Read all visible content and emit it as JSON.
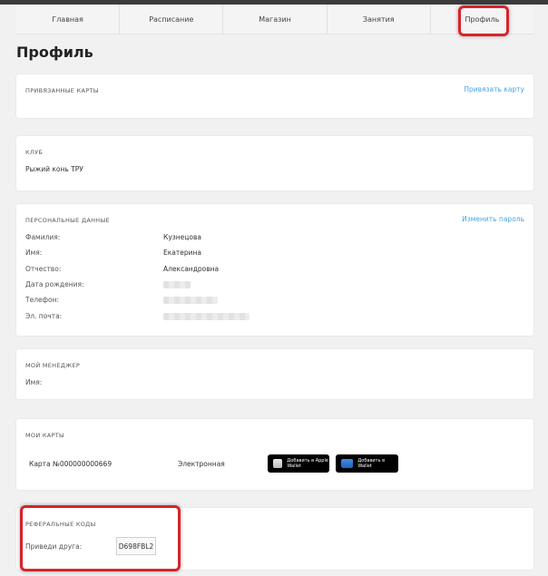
{
  "nav": {
    "items": [
      {
        "label": "Главная"
      },
      {
        "label": "Расписание"
      },
      {
        "label": "Магазин"
      },
      {
        "label": "Занятия"
      },
      {
        "label": "Профиль"
      }
    ]
  },
  "page": {
    "title": "Профиль"
  },
  "linked_cards": {
    "title": "ПРИВЯЗАННЫЕ КАРТЫ",
    "link": "Привязать карту"
  },
  "club": {
    "title": "КЛУБ",
    "value": "Рыжий конь ТРУ"
  },
  "personal": {
    "title": "ПЕРСОНАЛЬНЫЕ ДАННЫЕ",
    "link": "Изменить пароль",
    "fields": [
      {
        "label": "Фамилия:",
        "value": "Кузнецова"
      },
      {
        "label": "Имя:",
        "value": "Екатерина"
      },
      {
        "label": "Отчество:",
        "value": "Александровна"
      },
      {
        "label": "Дата рождения:",
        "value": ""
      },
      {
        "label": "Телефон:",
        "value": ""
      },
      {
        "label": "Эл. почта:",
        "value": ""
      }
    ]
  },
  "manager": {
    "title": "МОЙ МЕНЕДЖЕР",
    "name_label": "Имя:"
  },
  "my_cards": {
    "title": "МОИ КАРТЫ",
    "card_number": "Карта №000000000669",
    "card_type": "Электронная",
    "apple_wallet": "Добавить в Apple Wallet",
    "wallet": "Добавить в Wallet"
  },
  "referral": {
    "title": "РЕФЕРАЛЬНЫЕ КОДЫ",
    "label": "Приведи друга:",
    "code": "D698FBL2"
  },
  "colors": {
    "link": "#4aa3df",
    "highlight": "#d8232a"
  }
}
